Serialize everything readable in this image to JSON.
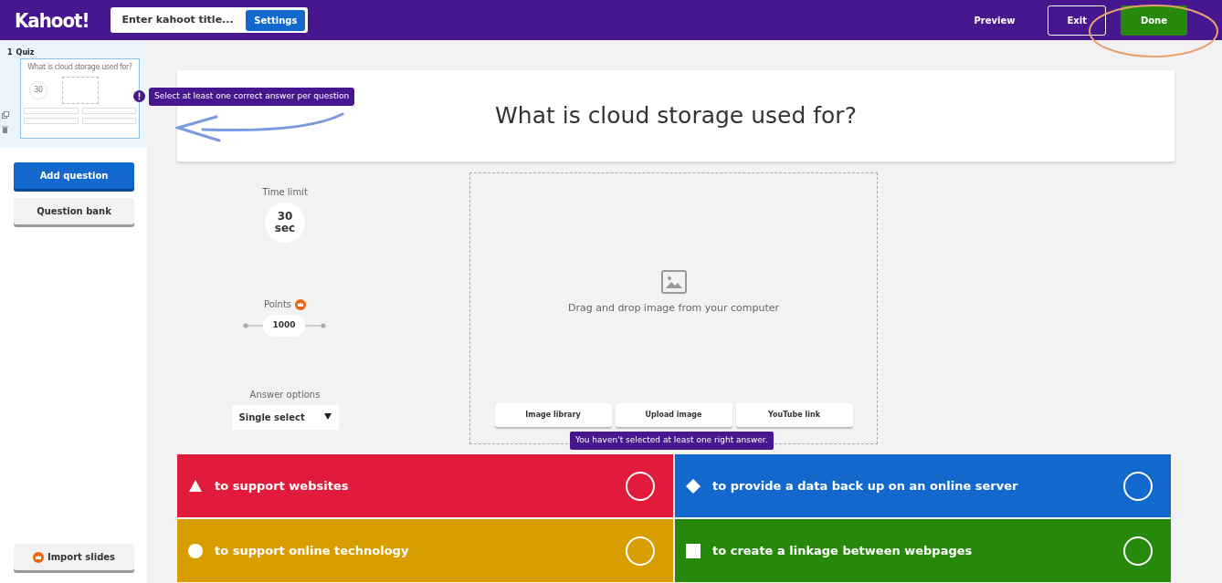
{
  "header": {
    "logo": "Kahoot!",
    "title_placeholder": "Enter kahoot title...",
    "settings": "Settings",
    "buttons": [
      {
        "label": "Preview",
        "kind": "link"
      },
      {
        "label": "Exit",
        "kind": "outline"
      },
      {
        "label": "Done",
        "kind": "primary"
      }
    ]
  },
  "sidebar": {
    "slides": [
      {
        "number": "1",
        "type": "Quiz",
        "question": "What is cloud storage used for?",
        "time": "30",
        "selected": true
      }
    ],
    "warning": "Select at least one correct answer per question",
    "buttons": [
      {
        "label": "Add question",
        "kind": "primary"
      },
      {
        "label": "Question bank",
        "kind": "plain"
      }
    ],
    "import": "Import slides"
  },
  "question": {
    "title": "What is cloud storage used for?"
  },
  "settings": {
    "time_label": "Time limit",
    "time_value": "30",
    "time_unit": "sec",
    "points_label": "Points",
    "points_value": "1000",
    "answer_label": "Answer options",
    "answer_value": "Single select"
  },
  "media": {
    "hint": "Drag and drop image from your computer",
    "buttons": [
      "Image library",
      "Upload image",
      "YouTube link"
    ]
  },
  "tooltip": "You haven't selected at least one right answer.",
  "answers": [
    {
      "text": "to support websites",
      "kind": "triangle",
      "color": "#e21b3c",
      "correct": false
    },
    {
      "text": "to provide a data back up on an online server",
      "kind": "diamond",
      "color": "#1368ce",
      "correct": false
    },
    {
      "text": "to support online technology",
      "kind": "circle",
      "color": "#d89e00",
      "correct": false
    },
    {
      "text": "to create a linkage between webpages",
      "kind": "square",
      "color": "#26890c",
      "correct": false
    }
  ]
}
